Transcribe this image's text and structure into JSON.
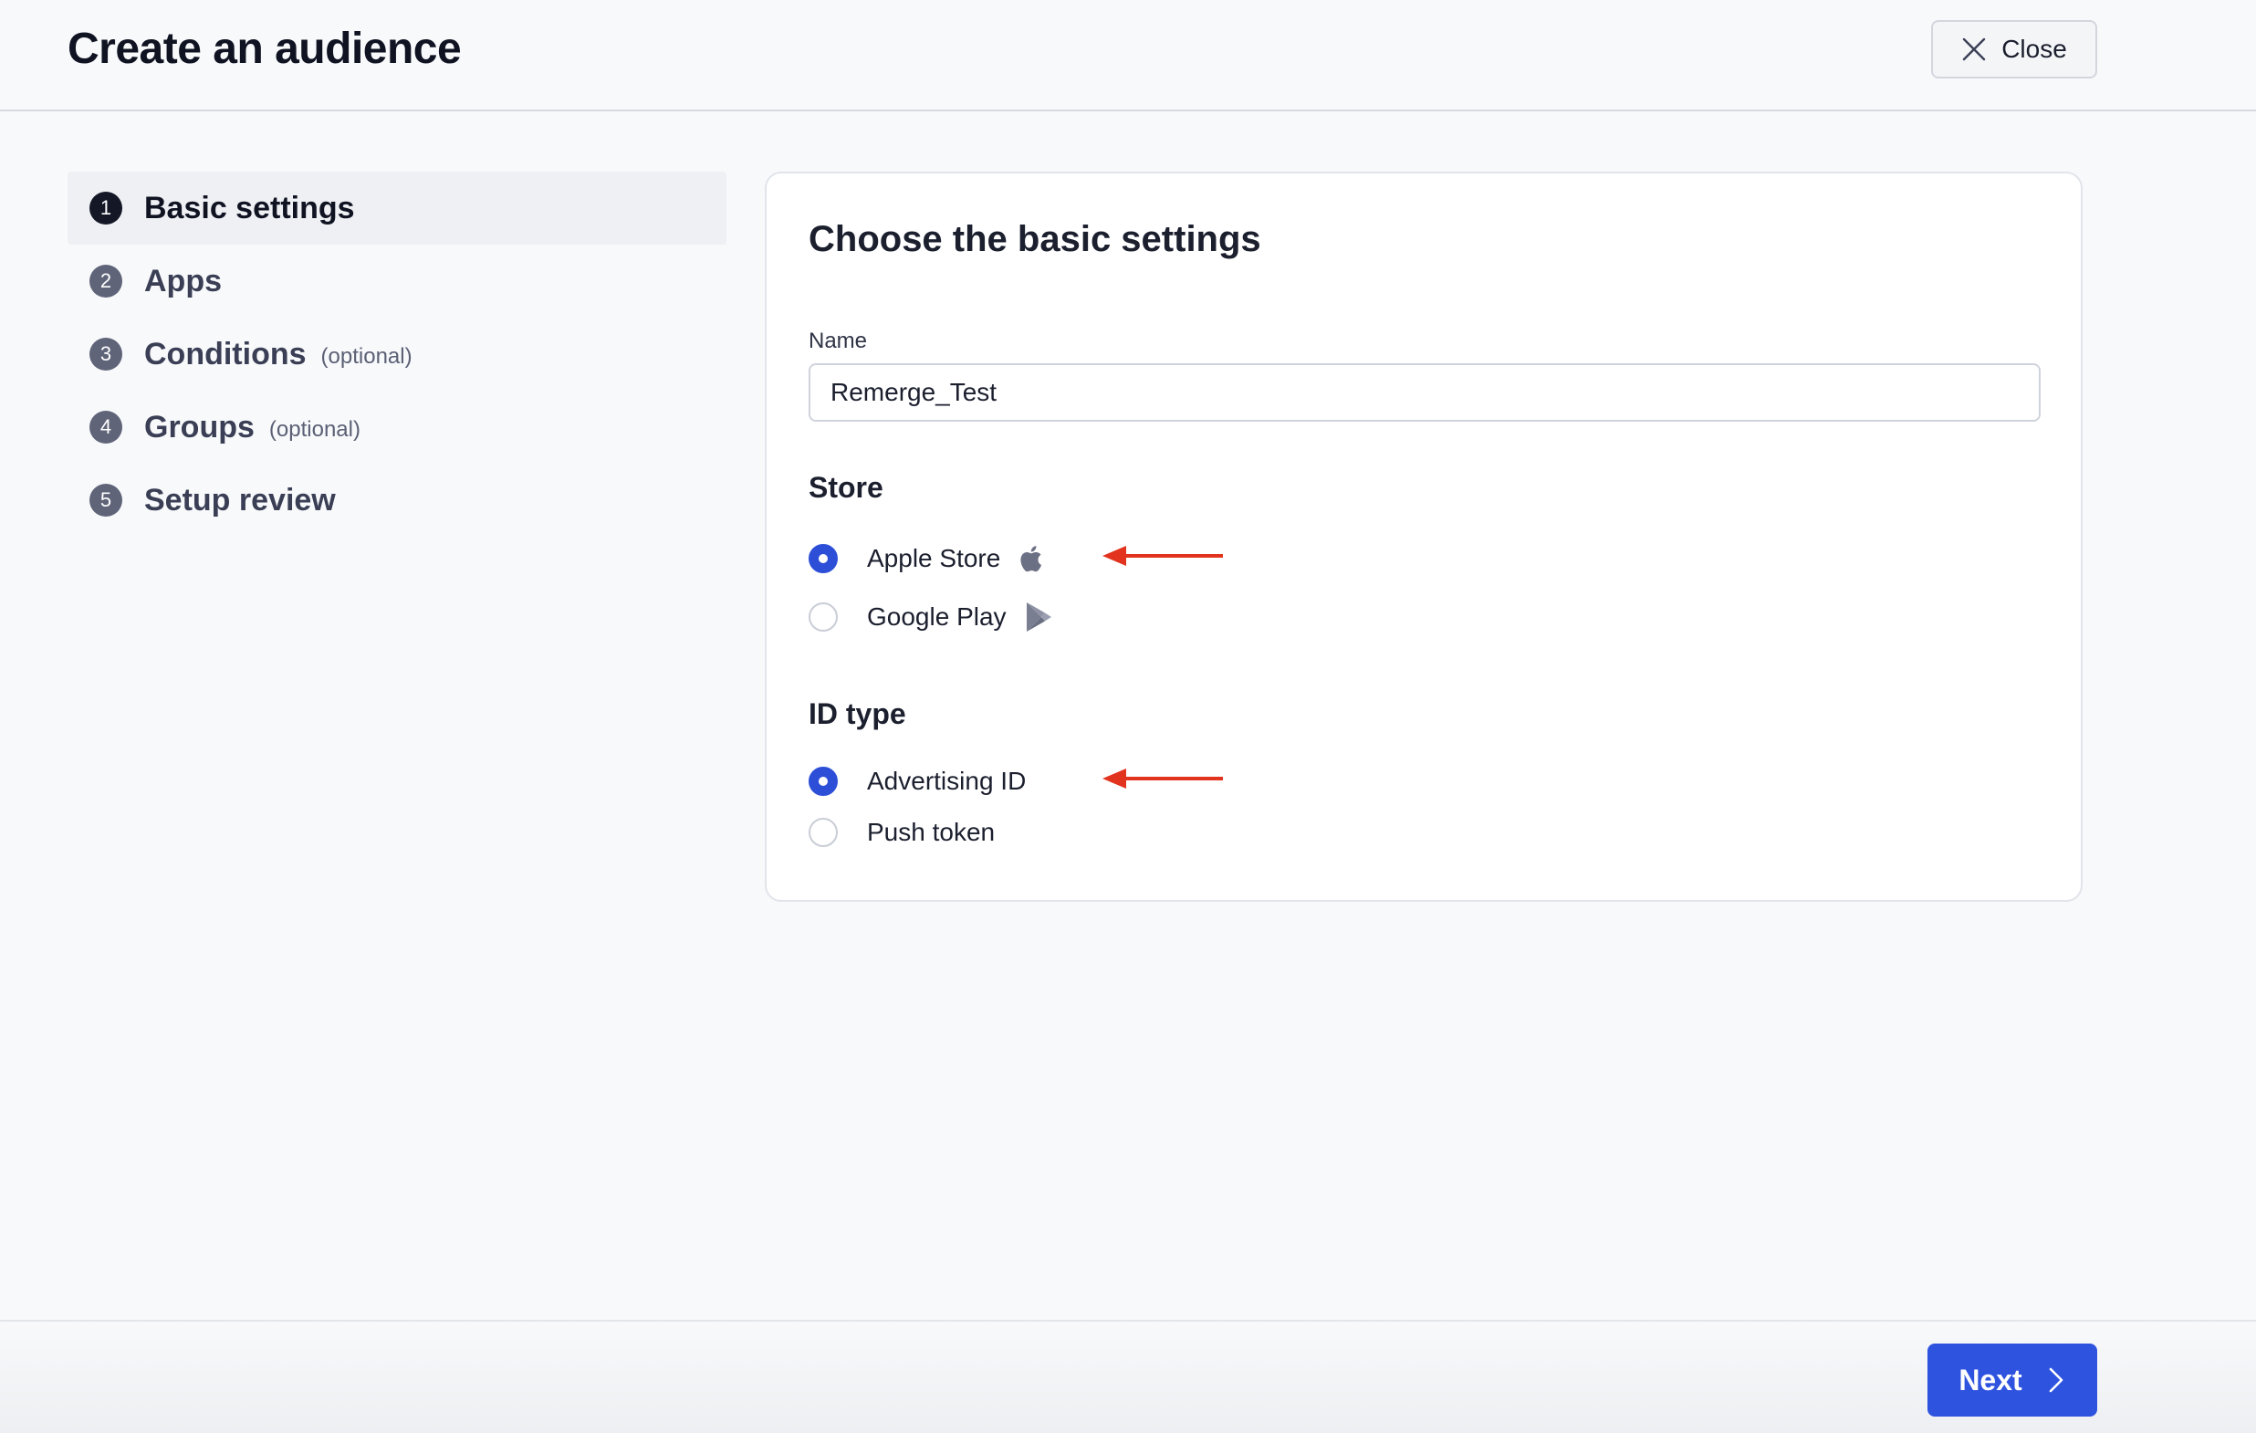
{
  "header": {
    "title": "Create an audience",
    "close_label": "Close"
  },
  "stepper": {
    "steps": [
      {
        "number": "1",
        "label": "Basic settings",
        "optional": "",
        "active": true
      },
      {
        "number": "2",
        "label": "Apps",
        "optional": "",
        "active": false
      },
      {
        "number": "3",
        "label": "Conditions",
        "optional": "(optional)",
        "active": false
      },
      {
        "number": "4",
        "label": "Groups",
        "optional": "(optional)",
        "active": false
      },
      {
        "number": "5",
        "label": "Setup review",
        "optional": "",
        "active": false
      }
    ]
  },
  "form": {
    "title": "Choose the basic settings",
    "name_label": "Name",
    "name_value": "Remerge_Test",
    "store": {
      "title": "Store",
      "options": [
        {
          "label": "Apple Store",
          "icon": "apple-icon",
          "selected": true
        },
        {
          "label": "Google Play",
          "icon": "google-play-icon",
          "selected": false
        }
      ]
    },
    "id_type": {
      "title": "ID type",
      "options": [
        {
          "label": "Advertising ID",
          "selected": true
        },
        {
          "label": "Push token",
          "selected": false
        }
      ]
    }
  },
  "footer": {
    "next_label": "Next"
  },
  "colors": {
    "primary": "#2e53df",
    "annotation_arrow": "#e2331f",
    "active_step": "#141726"
  }
}
